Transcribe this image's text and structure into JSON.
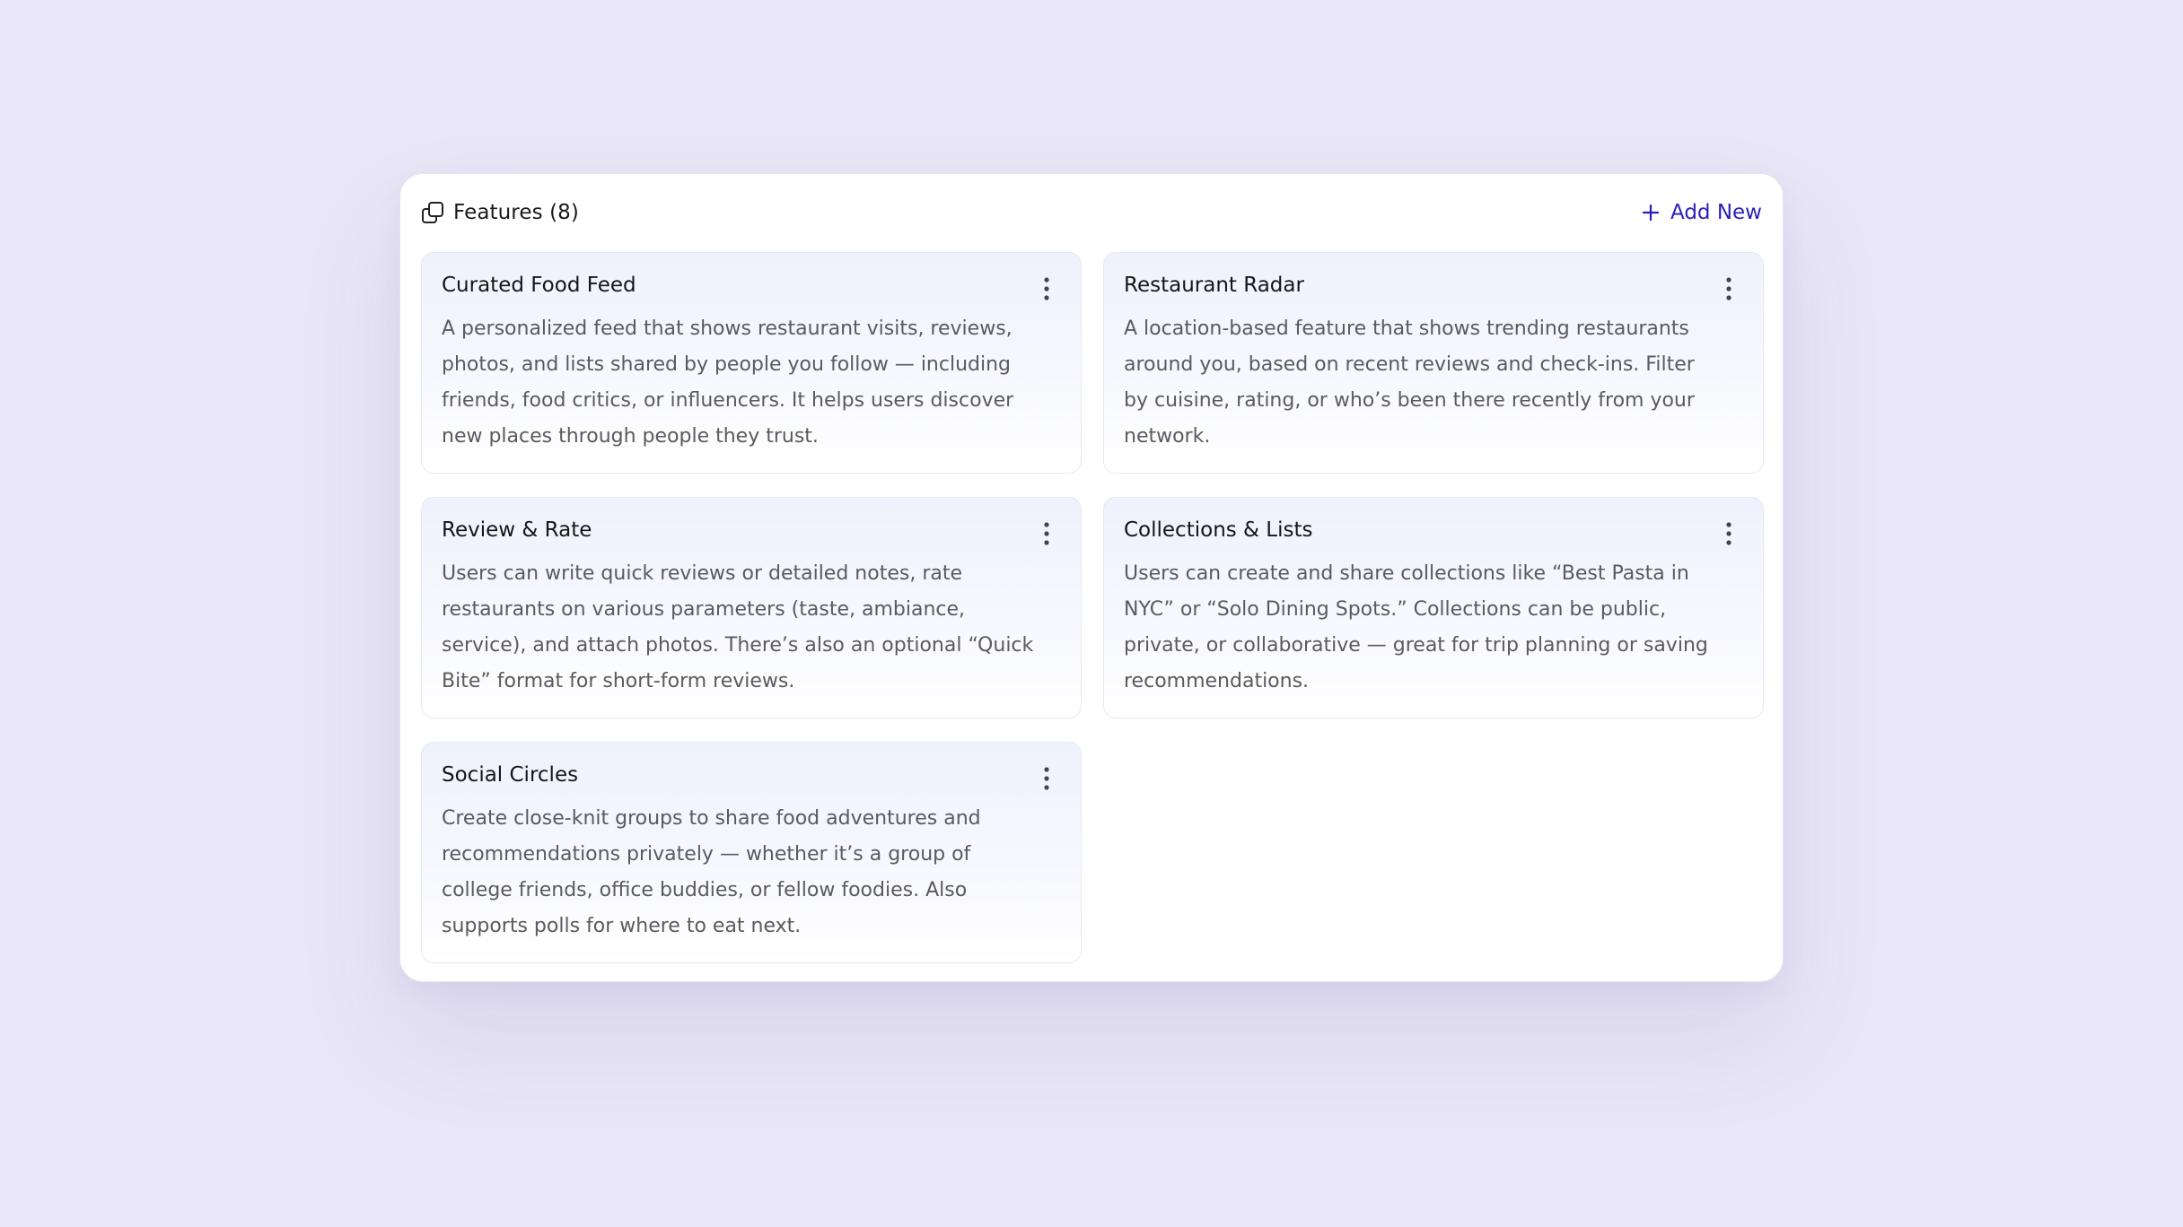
{
  "panel": {
    "title": "Features (8)",
    "title_icon": "copy-icon",
    "add_label": "Add New",
    "add_icon": "plus-icon",
    "accent_color": "#2a1fb8"
  },
  "features": [
    {
      "title": "Curated Food Feed",
      "description": "A personalized feed that shows restaurant visits, reviews, photos, and lists shared by people you follow — including friends, food critics, or influencers. It helps users discover new places through people they trust.",
      "menu_icon": "more-vertical-icon"
    },
    {
      "title": "Restaurant Radar",
      "description": "A location-based feature that shows trending restaurants around you, based on recent reviews and check-ins. Filter by cuisine, rating, or who’s been there recently from your network.",
      "menu_icon": "more-vertical-icon"
    },
    {
      "title": "Review & Rate",
      "description": "Users can write quick reviews or detailed notes, rate restaurants on various parameters (taste, ambiance, service), and attach photos. There’s also an optional “Quick Bite” format for short-form reviews.",
      "menu_icon": "more-vertical-icon"
    },
    {
      "title": "Collections & Lists",
      "description": "Users can create and share collections like “Best Pasta in NYC” or “Solo Dining Spots.” Collections can be public, private, or collaborative — great for trip planning or saving recommendations.",
      "menu_icon": "more-vertical-icon"
    },
    {
      "title": "Social Circles",
      "description": "Create close-knit groups to share food adventures and recommendations privately — whether it’s a group of college friends, office buddies, or fellow foodies. Also supports polls for where to eat next.",
      "menu_icon": "more-vertical-icon"
    }
  ]
}
